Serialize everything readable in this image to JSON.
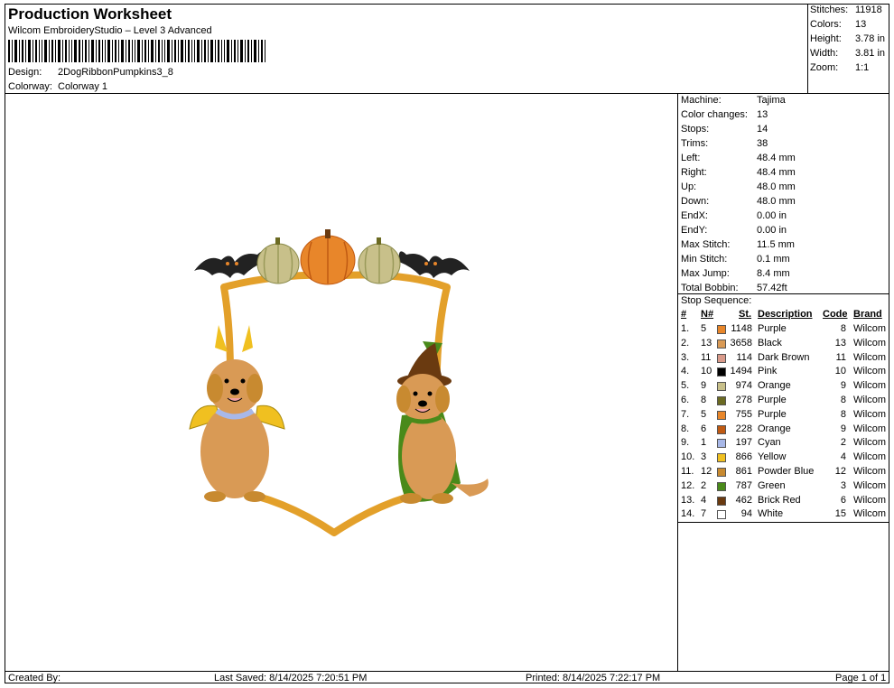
{
  "header": {
    "title": "Production Worksheet",
    "subtitle": "Wilcom EmbroideryStudio – Level 3 Advanced",
    "design_label": "Design:",
    "design_value": "2DogRibbonPumpkins3_8",
    "colorway_label": "Colorway:",
    "colorway_value": "Colorway 1"
  },
  "summary": [
    {
      "label": "Stitches:",
      "value": "11918"
    },
    {
      "label": "Colors:",
      "value": "13"
    },
    {
      "label": "Height:",
      "value": "3.78 in"
    },
    {
      "label": "Width:",
      "value": "3.81 in"
    },
    {
      "label": "Zoom:",
      "value": "1:1"
    }
  ],
  "specs": [
    {
      "label": "Machine:",
      "value": "Tajima"
    },
    {
      "label": "Color changes:",
      "value": "13"
    },
    {
      "label": "Stops:",
      "value": "14"
    },
    {
      "label": "Trims:",
      "value": "38"
    },
    {
      "label": "Left:",
      "value": "48.4 mm"
    },
    {
      "label": "Right:",
      "value": "48.4 mm"
    },
    {
      "label": "Up:",
      "value": "48.0 mm"
    },
    {
      "label": "Down:",
      "value": "48.0 mm"
    },
    {
      "label": "EndX:",
      "value": "0.00 in"
    },
    {
      "label": "EndY:",
      "value": "0.00 in"
    },
    {
      "label": "Max Stitch:",
      "value": "11.5 mm"
    },
    {
      "label": "Min Stitch:",
      "value": "0.1 mm"
    },
    {
      "label": "Max Jump:",
      "value": "8.4 mm"
    },
    {
      "label": "Total Bobbin:",
      "value": "57.42ft"
    }
  ],
  "stop_sequence": {
    "title": "Stop Sequence:",
    "headers": {
      "num": "#",
      "n": "N#",
      "st": "St.",
      "desc": "Description",
      "code": "Code",
      "brand": "Brand"
    },
    "rows": [
      {
        "num": "1.",
        "n": "5",
        "color": "#e8862a",
        "st": "1148",
        "desc": "Purple",
        "code": "8",
        "brand": "Wilcom"
      },
      {
        "num": "2.",
        "n": "13",
        "color": "#d99a55",
        "st": "3658",
        "desc": "Black",
        "code": "13",
        "brand": "Wilcom"
      },
      {
        "num": "3.",
        "n": "11",
        "color": "#d99a8a",
        "st": "114",
        "desc": "Dark Brown",
        "code": "11",
        "brand": "Wilcom"
      },
      {
        "num": "4.",
        "n": "10",
        "color": "#000000",
        "st": "1494",
        "desc": "Pink",
        "code": "10",
        "brand": "Wilcom"
      },
      {
        "num": "5.",
        "n": "9",
        "color": "#c8c08a",
        "st": "974",
        "desc": "Orange",
        "code": "9",
        "brand": "Wilcom"
      },
      {
        "num": "6.",
        "n": "8",
        "color": "#6b6a22",
        "st": "278",
        "desc": "Purple",
        "code": "8",
        "brand": "Wilcom"
      },
      {
        "num": "7.",
        "n": "5",
        "color": "#e8862a",
        "st": "755",
        "desc": "Purple",
        "code": "8",
        "brand": "Wilcom"
      },
      {
        "num": "8.",
        "n": "6",
        "color": "#c05a12",
        "st": "228",
        "desc": "Orange",
        "code": "9",
        "brand": "Wilcom"
      },
      {
        "num": "9.",
        "n": "1",
        "color": "#a8b8e8",
        "st": "197",
        "desc": "Cyan",
        "code": "2",
        "brand": "Wilcom"
      },
      {
        "num": "10.",
        "n": "3",
        "color": "#f0c020",
        "st": "866",
        "desc": "Yellow",
        "code": "4",
        "brand": "Wilcom"
      },
      {
        "num": "11.",
        "n": "12",
        "color": "#c88a30",
        "st": "861",
        "desc": "Powder Blue",
        "code": "12",
        "brand": "Wilcom"
      },
      {
        "num": "12.",
        "n": "2",
        "color": "#4a8a1a",
        "st": "787",
        "desc": "Green",
        "code": "3",
        "brand": "Wilcom"
      },
      {
        "num": "13.",
        "n": "4",
        "color": "#6a3a10",
        "st": "462",
        "desc": "Brick Red",
        "code": "6",
        "brand": "Wilcom"
      },
      {
        "num": "14.",
        "n": "7",
        "color": "#ffffff",
        "st": "94",
        "desc": "White",
        "code": "15",
        "brand": "Wilcom"
      }
    ]
  },
  "footer": {
    "created_by": "Created By:",
    "last_saved": "Last Saved: 8/14/2025 7:20:51 PM",
    "printed": "Printed: 8/14/2025 7:22:17 PM",
    "page": "Page 1 of 1"
  }
}
